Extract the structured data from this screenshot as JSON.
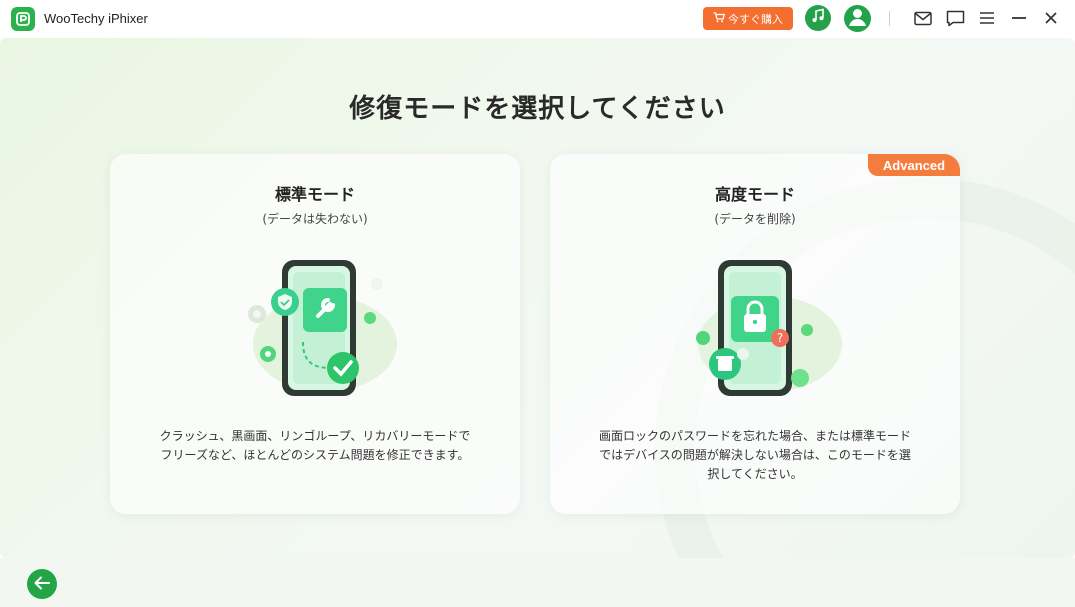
{
  "app": {
    "title": "WooTechy iPhixer",
    "logo_icon": "app-logo-icon"
  },
  "header": {
    "buy_label": "今すぐ購入",
    "buy_icon": "cart-icon",
    "music_icon": "music-note-icon",
    "user_icon": "user-icon",
    "mail_icon": "mail-icon",
    "feedback_icon": "chat-icon",
    "menu_icon": "menu-icon",
    "minimize_icon": "minimize-icon",
    "close_icon": "close-icon"
  },
  "main": {
    "title": "修復モードを選択してください"
  },
  "cards": [
    {
      "title": "標準モード",
      "subtitle": "(データは失わない)",
      "description": "クラッシュ、黒画面、リンゴループ、リカバリーモードでフリーズなど、ほとんどのシステム問題を修正できます。",
      "illustration_icon": "phone-repair-icon"
    },
    {
      "title": "高度モード",
      "subtitle": "(データを削除)",
      "badge": "Advanced",
      "description": "画面ロックのパスワードを忘れた場合、または標準モードではデバイスの問題が解決しない場合は、このモードを選択してください。",
      "illustration_icon": "phone-lock-icon"
    }
  ],
  "footer": {
    "back_icon": "back-arrow-icon"
  },
  "colors": {
    "accent": "#22a447",
    "badge": "#f47c3c",
    "buy": "#f46e2f"
  }
}
